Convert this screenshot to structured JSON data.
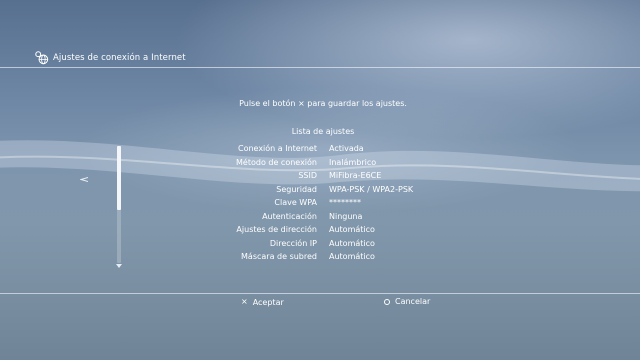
{
  "header": {
    "title": "Ajustes de conexión a Internet",
    "icon": "network-globe-icon"
  },
  "instruction": {
    "before": "Pulse el botón",
    "button_glyph": "×",
    "after": "para guardar los ajustes."
  },
  "list": {
    "title": "Lista de ajustes",
    "rows": [
      {
        "label": "Conexión a Internet",
        "value": "Activada"
      },
      {
        "label": "Método de conexión",
        "value": "Inalámbrico"
      },
      {
        "label": "SSID",
        "value": "MiFibra-E6CE"
      },
      {
        "label": "Seguridad",
        "value": "WPA-PSK / WPA2-PSK"
      },
      {
        "label": "Clave WPA",
        "value": "********"
      },
      {
        "label": "Autenticación",
        "value": "Ninguna"
      },
      {
        "label": "Ajustes de dirección",
        "value": "Automático"
      },
      {
        "label": "Dirección IP",
        "value": "Automático"
      },
      {
        "label": "Máscara de subred",
        "value": "Automático"
      }
    ]
  },
  "footer": {
    "accept": {
      "glyph": "×",
      "label": "Aceptar"
    },
    "cancel": {
      "glyph": "○",
      "label": "Cancelar"
    }
  },
  "colors": {
    "text": "#ffffff",
    "background_top": "#58708f",
    "background_bottom": "#6f8497"
  }
}
